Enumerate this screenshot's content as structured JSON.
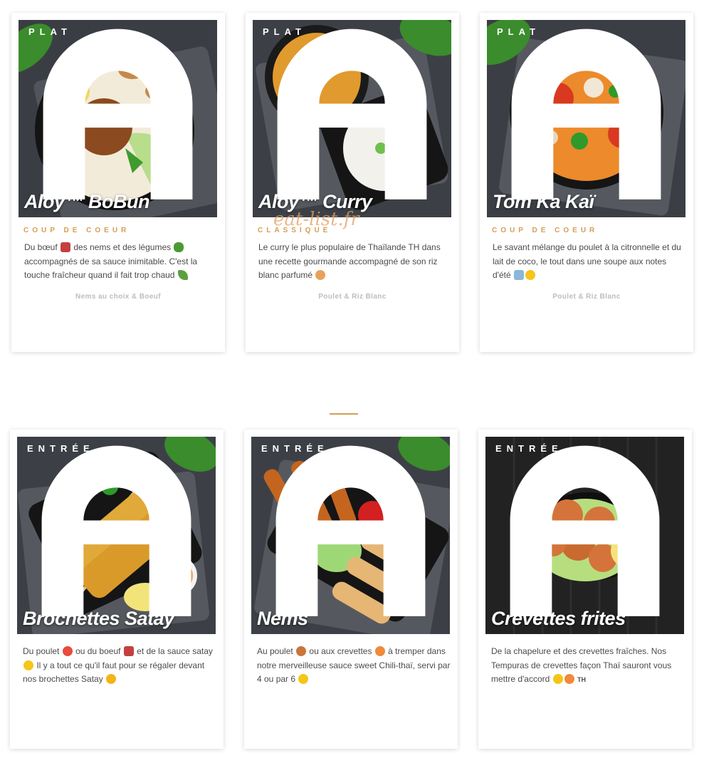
{
  "watermark": "eat-list.fr",
  "cards": [
    {
      "category": "PLAT",
      "dish_name": "Aloy™ BoBun",
      "tag": "COUP DE COEUR",
      "description": [
        "Du bœuf",
        "des nems et des légumes",
        "accompagnés de sa sauce inimitable. C'est la touche fraîcheur quand il fait trop chaud"
      ],
      "subtitle": "Nems au choix & Boeuf"
    },
    {
      "category": "PLAT",
      "dish_name": "Aloy™ Curry",
      "tag": "CLASSIQUE",
      "description": [
        "Le curry le plus populaire de Thaïlande TH dans une recette gourmande accompagné de son riz blanc parfumé"
      ],
      "subtitle": "Poulet & Riz Blanc"
    },
    {
      "category": "PLAT",
      "dish_name": "Tom Ka Kaï",
      "tag": "COUP DE COEUR",
      "description": [
        "Le savant mélange du poulet à la citronnelle et du lait de coco, le tout dans une soupe aux notes d'été"
      ],
      "subtitle": "Poulet & Riz Blanc"
    },
    {
      "category": "ENTRÉE",
      "dish_name": "Brochettes Satay",
      "description": [
        "Du poulet",
        "ou du boeuf",
        "et de la sauce satay",
        "Il y a tout ce qu'il faut pour se régaler devant nos brochettes Satay"
      ]
    },
    {
      "category": "ENTRÉE",
      "dish_name": "Nems",
      "description": [
        "Au poulet",
        "ou aux crevettes",
        "à tremper dans notre merveilleuse sauce sweet Chili-thaï, servi par 4 ou par 6"
      ]
    },
    {
      "category": "ENTRÉE",
      "dish_name": "Crevettes frites",
      "description": [
        "De la chapelure et des crevettes fraîches. Nos Tempuras de crevettes façon Thaï sauront vous mettre d'accord",
        "TH"
      ]
    }
  ],
  "colors": {
    "accent": "#d39f52",
    "text": "#4b4b4b",
    "subtitle": "#bdbdbd",
    "photo_bg": "#3a3d42"
  }
}
